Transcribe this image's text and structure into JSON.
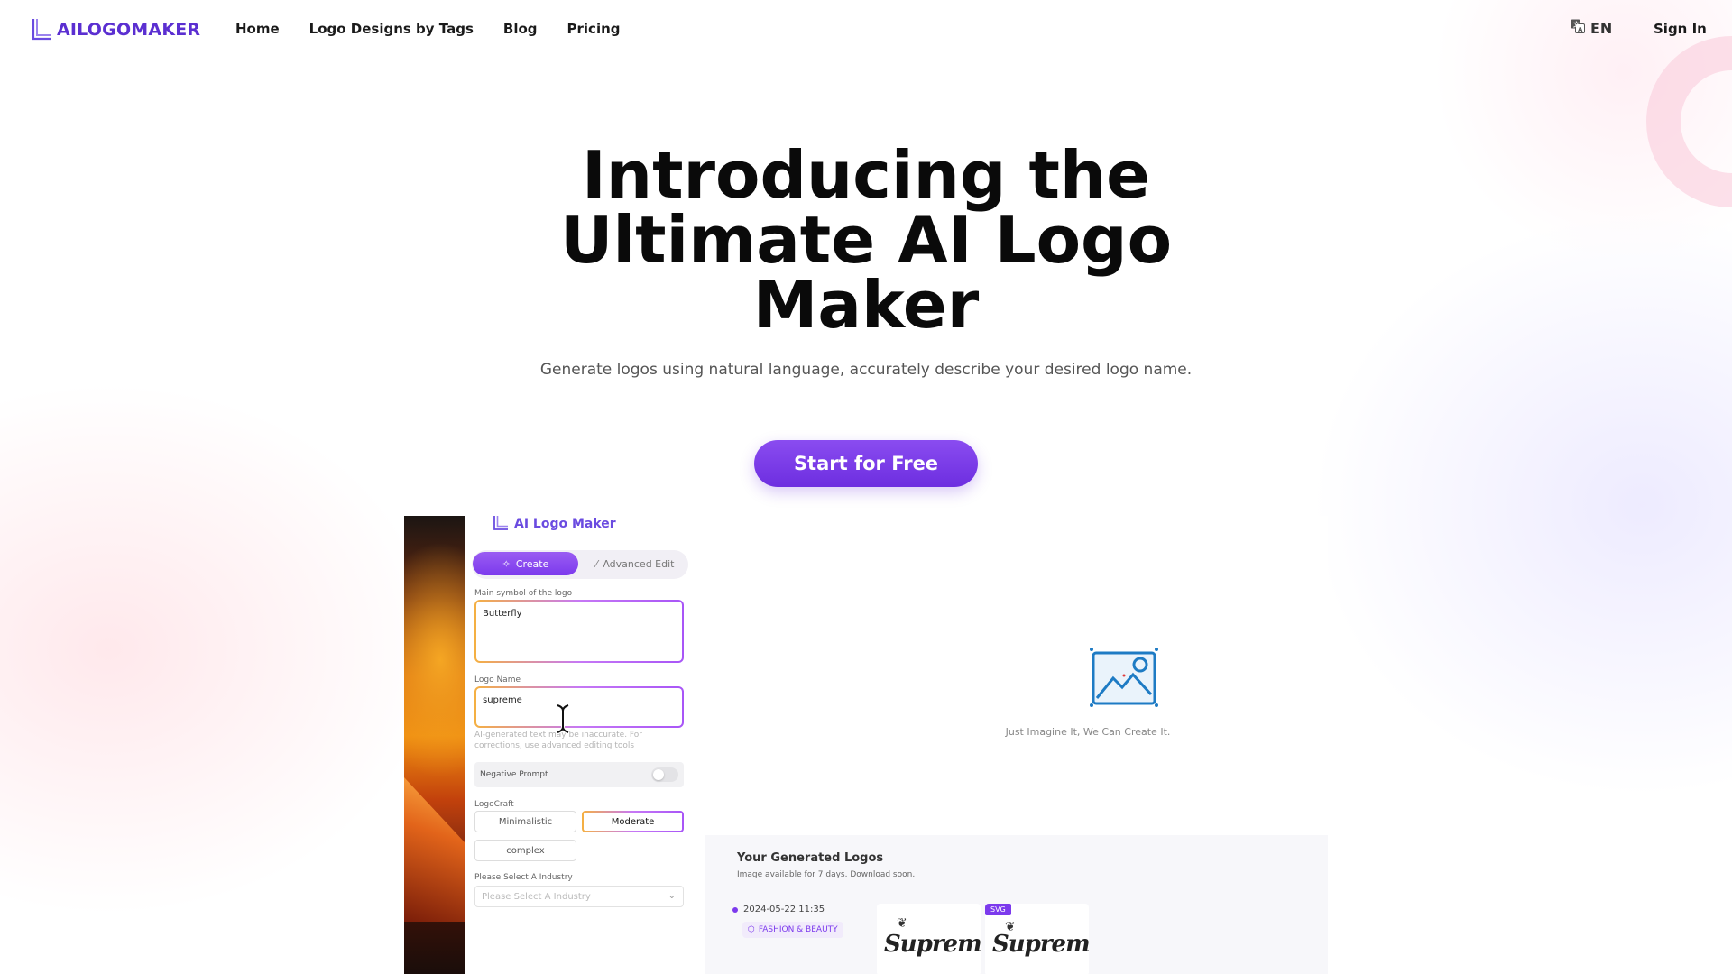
{
  "header": {
    "brand": "AILOGOMAKER",
    "nav": [
      "Home",
      "Logo Designs by Tags",
      "Blog",
      "Pricing"
    ],
    "lang": "EN",
    "signin": "Sign In"
  },
  "hero": {
    "title": "Introducing the Ultimate AI Logo Maker",
    "subtitle": "Generate logos using natural language, accurately describe your desired logo name.",
    "cta": "Start for Free"
  },
  "app": {
    "brand": "AI Logo Maker",
    "tabs": [
      "Create",
      "Advanced Edit"
    ],
    "symbol_label": "Main symbol of the logo",
    "symbol_value": "Butterfly",
    "name_label": "Logo Name",
    "name_value": "supreme",
    "hint": "AI-generated text may be inaccurate. For corrections, use advanced editing tools",
    "negative_prompt": "Negative Prompt",
    "logocraft_label": "LogoCraft",
    "logocraft_options": [
      "Minimalistic",
      "Moderate",
      "complex"
    ],
    "logocraft_selected": "Moderate",
    "industry_label": "Please Select A Industry",
    "industry_placeholder": "Please Select A Industry",
    "canvas_caption": "Just Imagine It, We Can Create It.",
    "generated": {
      "title": "Your Generated Logos",
      "subtitle": "Image available for 7 days. Download soon.",
      "date": "2024-05-22 11:35",
      "tag": "FASHION & BEAUTY",
      "badge": "SVG",
      "logos": [
        "Supreme",
        "Supreme"
      ]
    }
  },
  "colors": {
    "accent": "#7c3aed",
    "brand": "#5b2fd1"
  }
}
